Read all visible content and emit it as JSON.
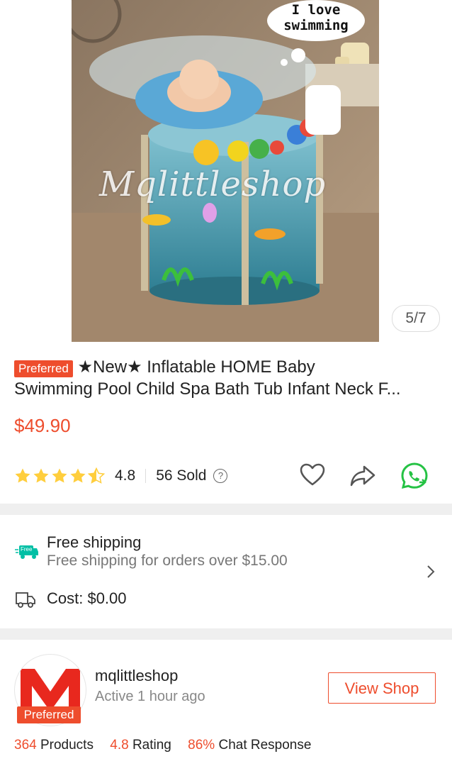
{
  "image": {
    "counter": "5/7",
    "speech_bubble_line1": "I love",
    "speech_bubble_line2": "swimming",
    "watermark": "Mqlittleshop"
  },
  "product": {
    "badge": "Preferred",
    "title_line1": "★New★ Inflatable HOME Baby",
    "title_line2": "Swimming Pool Child Spa Bath Tub Infant Neck F...",
    "price": "$49.90",
    "rating": "4.8",
    "stars": 4.5,
    "sold": "56 Sold",
    "help_icon": "question-circle-icon"
  },
  "actions": {
    "like_icon": "heart-icon",
    "share_icon": "share-icon",
    "whatsapp_icon": "whatsapp-icon"
  },
  "shipping": {
    "free_badge": "Free",
    "title": "Free shipping",
    "subtitle": "Free shipping for orders over $15.00",
    "cost": "Cost: $0.00"
  },
  "shop": {
    "name": "mqlittleshop",
    "active": "Active 1 hour ago",
    "badge": "Preferred",
    "view_button": "View Shop",
    "products_count": "364",
    "products_label": "Products",
    "rating_value": "4.8",
    "rating_label": "Rating",
    "chat_value": "86%",
    "chat_label": "Chat Response"
  },
  "colors": {
    "accent": "#ee4d2d",
    "star": "#ffce3d",
    "whatsapp": "#25c244",
    "shipping_teal": "#00bfa5"
  }
}
